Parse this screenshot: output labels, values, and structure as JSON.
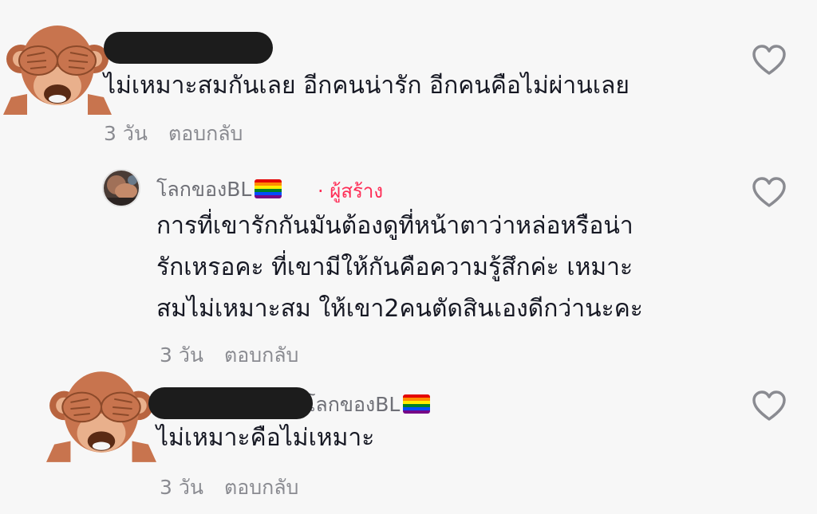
{
  "comments": [
    {
      "text": "ไม่เหมาะสมกันเลย อีกคนน่ารัก อีกคนคือไม่ผ่านเลย",
      "time": "3 วัน",
      "reply_label": "ตอบกลับ"
    },
    {
      "username": "โลกของBL",
      "flag_icon": "rainbow-flag-icon",
      "creator_label": "· ผู้สร้าง",
      "text_lines": [
        "การที่เขารักกันมันต้องดูที่หน้าตาว่าหล่อหรือน่า",
        "รักเหรอคะ ที่เขามีให้กันคือความรู้สึกค่ะ เหมาะ",
        "สมไม่เหมาะสม ให้เขา2คนตัดสินเองดีกว่านะคะ"
      ],
      "time": "3 วัน",
      "reply_label": "ตอบกลับ"
    },
    {
      "reply_to": "โลกของBL",
      "flag_icon": "rainbow-flag-icon",
      "text": "ไม่เหมาะคือไม่เหมาะ",
      "time": "3 วัน",
      "reply_label": "ตอบกลับ"
    }
  ],
  "colors": {
    "background": "#f7f7f7",
    "text": "#161823",
    "meta": "#8a8b91",
    "creator": "#fe2c55",
    "redaction": "#1c1c1c",
    "monkey": "#c8744e"
  }
}
